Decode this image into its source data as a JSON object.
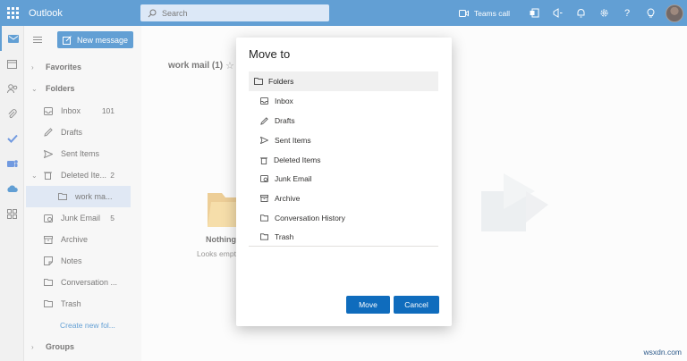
{
  "topbar": {
    "app_name": "Outlook",
    "search_placeholder": "Search",
    "teams_call": "Teams call"
  },
  "sidebar": {
    "new_message": "New message",
    "favorites": "Favorites",
    "folders": "Folders",
    "items": [
      {
        "label": "Inbox",
        "count": "101",
        "icon": "inbox-icon"
      },
      {
        "label": "Drafts",
        "count": "",
        "icon": "pencil-icon"
      },
      {
        "label": "Sent Items",
        "count": "",
        "icon": "send-icon"
      },
      {
        "label": "Deleted Ite...",
        "count": "2",
        "icon": "trash-icon"
      },
      {
        "label": "work ma...",
        "count": "",
        "icon": "folder-icon"
      },
      {
        "label": "Junk Email",
        "count": "5",
        "icon": "junk-icon"
      },
      {
        "label": "Archive",
        "count": "",
        "icon": "archive-icon"
      },
      {
        "label": "Notes",
        "count": "",
        "icon": "notes-icon"
      },
      {
        "label": "Conversation ...",
        "count": "",
        "icon": "folder-icon"
      },
      {
        "label": "Trash",
        "count": "",
        "icon": "folder-icon"
      }
    ],
    "create_folder": "Create new fol...",
    "groups": "Groups"
  },
  "list": {
    "title": "work mail (1)",
    "empty_title": "Nothing",
    "empty_sub": "Looks empty"
  },
  "dialog": {
    "title": "Move to",
    "root": "Folders",
    "items": [
      {
        "label": "Inbox",
        "icon": "inbox-icon"
      },
      {
        "label": "Drafts",
        "icon": "pencil-icon"
      },
      {
        "label": "Sent Items",
        "icon": "send-icon"
      },
      {
        "label": "Deleted Items",
        "icon": "trash-icon"
      },
      {
        "label": "Junk Email",
        "icon": "junk-icon"
      },
      {
        "label": "Archive",
        "icon": "archive-icon"
      },
      {
        "label": "Conversation History",
        "icon": "folder-icon"
      },
      {
        "label": "Trash",
        "icon": "folder-icon"
      }
    ],
    "move_label": "Move",
    "cancel_label": "Cancel"
  },
  "watermark": "wsxdn.com",
  "colors": {
    "accent": "#0f6cbd",
    "selected": "#cfdcee"
  }
}
